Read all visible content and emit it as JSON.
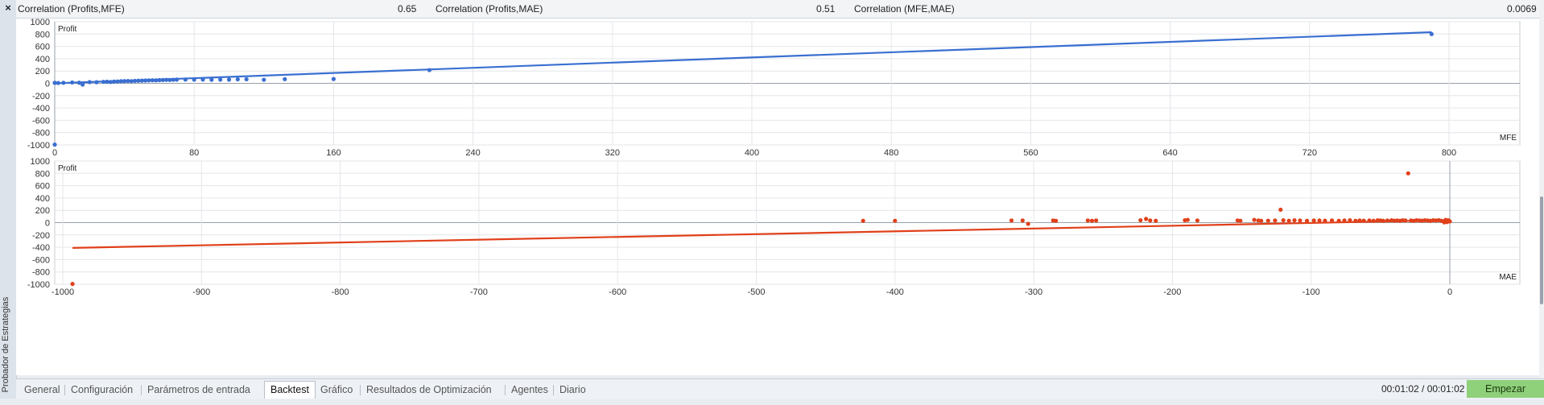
{
  "panel": {
    "title": "Probador de Estrategias",
    "close_symbol": "×"
  },
  "correlations": [
    {
      "label": "Correlation (Profits,MFE)",
      "value": "0.65"
    },
    {
      "label": "Correlation (Profits,MAE)",
      "value": "0.51"
    },
    {
      "label": "Correlation (MFE,MAE)",
      "value": "0.0069"
    }
  ],
  "chart_data": [
    {
      "type": "scatter",
      "ylabel": "Profit",
      "xlabel": "MFE",
      "xlim": [
        0,
        820
      ],
      "ylim": [
        -1000,
        1000
      ],
      "xticks": [
        0,
        80,
        160,
        240,
        320,
        400,
        480,
        560,
        640,
        720,
        800
      ],
      "yticks": [
        1000,
        800,
        600,
        400,
        200,
        0,
        -200,
        -400,
        -600,
        -800,
        -1000
      ],
      "grid": true,
      "color": "#3a6fd1",
      "points": [
        [
          0,
          -995
        ],
        [
          0,
          8
        ],
        [
          2,
          6
        ],
        [
          5,
          9
        ],
        [
          10,
          14
        ],
        [
          14,
          10
        ],
        [
          16,
          -20
        ],
        [
          20,
          20
        ],
        [
          24,
          18
        ],
        [
          28,
          24
        ],
        [
          30,
          26
        ],
        [
          32,
          22
        ],
        [
          34,
          28
        ],
        [
          36,
          30
        ],
        [
          38,
          34
        ],
        [
          40,
          36
        ],
        [
          42,
          38
        ],
        [
          44,
          35
        ],
        [
          46,
          40
        ],
        [
          48,
          42
        ],
        [
          50,
          44
        ],
        [
          52,
          46
        ],
        [
          54,
          48
        ],
        [
          56,
          50
        ],
        [
          58,
          48
        ],
        [
          60,
          52
        ],
        [
          62,
          54
        ],
        [
          64,
          56
        ],
        [
          66,
          55
        ],
        [
          68,
          58
        ],
        [
          70,
          60
        ],
        [
          75,
          62
        ],
        [
          80,
          60
        ],
        [
          85,
          62
        ],
        [
          90,
          58
        ],
        [
          95,
          60
        ],
        [
          100,
          60
        ],
        [
          105,
          65
        ],
        [
          110,
          66
        ],
        [
          120,
          58
        ],
        [
          132,
          68
        ],
        [
          160,
          70
        ],
        [
          215,
          215
        ],
        [
          790,
          800
        ]
      ],
      "trend": [
        [
          0,
          0
        ],
        [
          790,
          830
        ]
      ]
    },
    {
      "type": "scatter",
      "ylabel": "Profit",
      "xlabel": "MAE",
      "xlim": [
        -1010,
        10
      ],
      "ylim": [
        -1000,
        1000
      ],
      "xticks": [
        -1000,
        -900,
        -800,
        -700,
        -600,
        -500,
        -400,
        -300,
        -200,
        -100,
        0
      ],
      "yticks": [
        1000,
        800,
        600,
        400,
        200,
        0,
        -200,
        -400,
        -600,
        -800,
        -1000
      ],
      "grid": true,
      "color": "#e0401a",
      "points": [
        [
          -993,
          -995
        ],
        [
          -423,
          30
        ],
        [
          -400,
          30
        ],
        [
          -316,
          35
        ],
        [
          -308,
          35
        ],
        [
          -304,
          -20
        ],
        [
          -286,
          35
        ],
        [
          -284,
          30
        ],
        [
          -261,
          35
        ],
        [
          -258,
          30
        ],
        [
          -255,
          35
        ],
        [
          -223,
          38
        ],
        [
          -219,
          60
        ],
        [
          -216,
          35
        ],
        [
          -212,
          30
        ],
        [
          -191,
          38
        ],
        [
          -189,
          45
        ],
        [
          -182,
          35
        ],
        [
          -153,
          35
        ],
        [
          -151,
          30
        ],
        [
          -141,
          45
        ],
        [
          -138,
          35
        ],
        [
          -136,
          30
        ],
        [
          -131,
          32
        ],
        [
          -126,
          35
        ],
        [
          -122,
          210
        ],
        [
          -120,
          38
        ],
        [
          -116,
          30
        ],
        [
          -112,
          38
        ],
        [
          -108,
          35
        ],
        [
          -103,
          30
        ],
        [
          -98,
          35
        ],
        [
          -94,
          35
        ],
        [
          -90,
          32
        ],
        [
          -85,
          35
        ],
        [
          -80,
          30
        ],
        [
          -76,
          35
        ],
        [
          -72,
          38
        ],
        [
          -68,
          30
        ],
        [
          -65,
          35
        ],
        [
          -62,
          32
        ],
        [
          -58,
          35
        ],
        [
          -55,
          30
        ],
        [
          -52,
          38
        ],
        [
          -50,
          35
        ],
        [
          -48,
          30
        ],
        [
          -45,
          35
        ],
        [
          -42,
          38
        ],
        [
          -40,
          32
        ],
        [
          -38,
          35
        ],
        [
          -36,
          30
        ],
        [
          -34,
          38
        ],
        [
          -32,
          35
        ],
        [
          -30,
          800
        ],
        [
          -28,
          35
        ],
        [
          -26,
          30
        ],
        [
          -24,
          38
        ],
        [
          -22,
          35
        ],
        [
          -20,
          32
        ],
        [
          -18,
          38
        ],
        [
          -16,
          35
        ],
        [
          -14,
          30
        ],
        [
          -12,
          38
        ],
        [
          -10,
          35
        ],
        [
          -8,
          40
        ],
        [
          -6,
          30
        ],
        [
          -4,
          5
        ],
        [
          -3,
          45
        ],
        [
          -2,
          10
        ],
        [
          -1,
          38
        ],
        [
          0,
          20
        ]
      ],
      "trend": [
        [
          -993,
          -410
        ],
        [
          0,
          40
        ]
      ]
    }
  ],
  "tabs": [
    {
      "label": "General",
      "active": false
    },
    {
      "label": "Configuración",
      "active": false
    },
    {
      "label": "Parámetros de entrada",
      "active": false
    },
    {
      "label": "Backtest",
      "active": true
    },
    {
      "label": "Gráfico",
      "active": false
    },
    {
      "label": "Resultados de Optimización",
      "active": false
    },
    {
      "label": "Agentes",
      "active": false
    },
    {
      "label": "Diario",
      "active": false
    }
  ],
  "status": {
    "time": "00:01:02 / 00:01:02"
  },
  "start_button": {
    "label": "Empezar",
    "color": "#8fd07a"
  }
}
